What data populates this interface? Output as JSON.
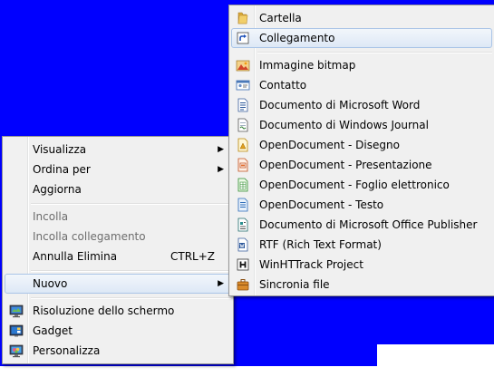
{
  "context_menu": {
    "items": [
      {
        "label": "Visualizza",
        "submenu": true
      },
      {
        "label": "Ordina per",
        "submenu": true
      },
      {
        "label": "Aggiorna"
      },
      {
        "label": "Incolla",
        "disabled": true
      },
      {
        "label": "Incolla collegamento",
        "disabled": true
      },
      {
        "label": "Annulla Elimina",
        "shortcut": "CTRL+Z"
      },
      {
        "label": "Nuovo",
        "submenu": true,
        "highlighted": true
      },
      {
        "label": "Risoluzione dello schermo",
        "icon": "display-icon"
      },
      {
        "label": "Gadget",
        "icon": "gadget-icon"
      },
      {
        "label": "Personalizza",
        "icon": "personalize-icon"
      }
    ],
    "submenu_arrow": "▶"
  },
  "new_submenu": {
    "items": [
      {
        "label": "Cartella",
        "icon": "folder-icon"
      },
      {
        "label": "Collegamento",
        "icon": "shortcut-icon",
        "highlighted": true
      },
      {
        "label": "Immagine bitmap",
        "icon": "bitmap-icon"
      },
      {
        "label": "Contatto",
        "icon": "contact-icon"
      },
      {
        "label": "Documento di Microsoft Word",
        "icon": "word-document-icon"
      },
      {
        "label": "Documento di Windows Journal",
        "icon": "journal-document-icon"
      },
      {
        "label": "OpenDocument - Disegno",
        "icon": "odg-drawing-icon"
      },
      {
        "label": "OpenDocument - Presentazione",
        "icon": "odp-presentation-icon"
      },
      {
        "label": "OpenDocument - Foglio elettronico",
        "icon": "ods-spreadsheet-icon"
      },
      {
        "label": "OpenDocument - Testo",
        "icon": "odt-text-icon"
      },
      {
        "label": "Documento di Microsoft Office Publisher",
        "icon": "publisher-document-icon"
      },
      {
        "label": "RTF (Rich Text Format)",
        "icon": "rtf-document-icon"
      },
      {
        "label": "WinHTTrack Project",
        "icon": "httrack-project-icon"
      },
      {
        "label": "Sincronia file",
        "icon": "briefcase-icon"
      }
    ]
  },
  "colors": {
    "desktop_background": "#0000ff",
    "menu_background": "#f0f0f0",
    "highlight_border": "#a9c4e7"
  }
}
